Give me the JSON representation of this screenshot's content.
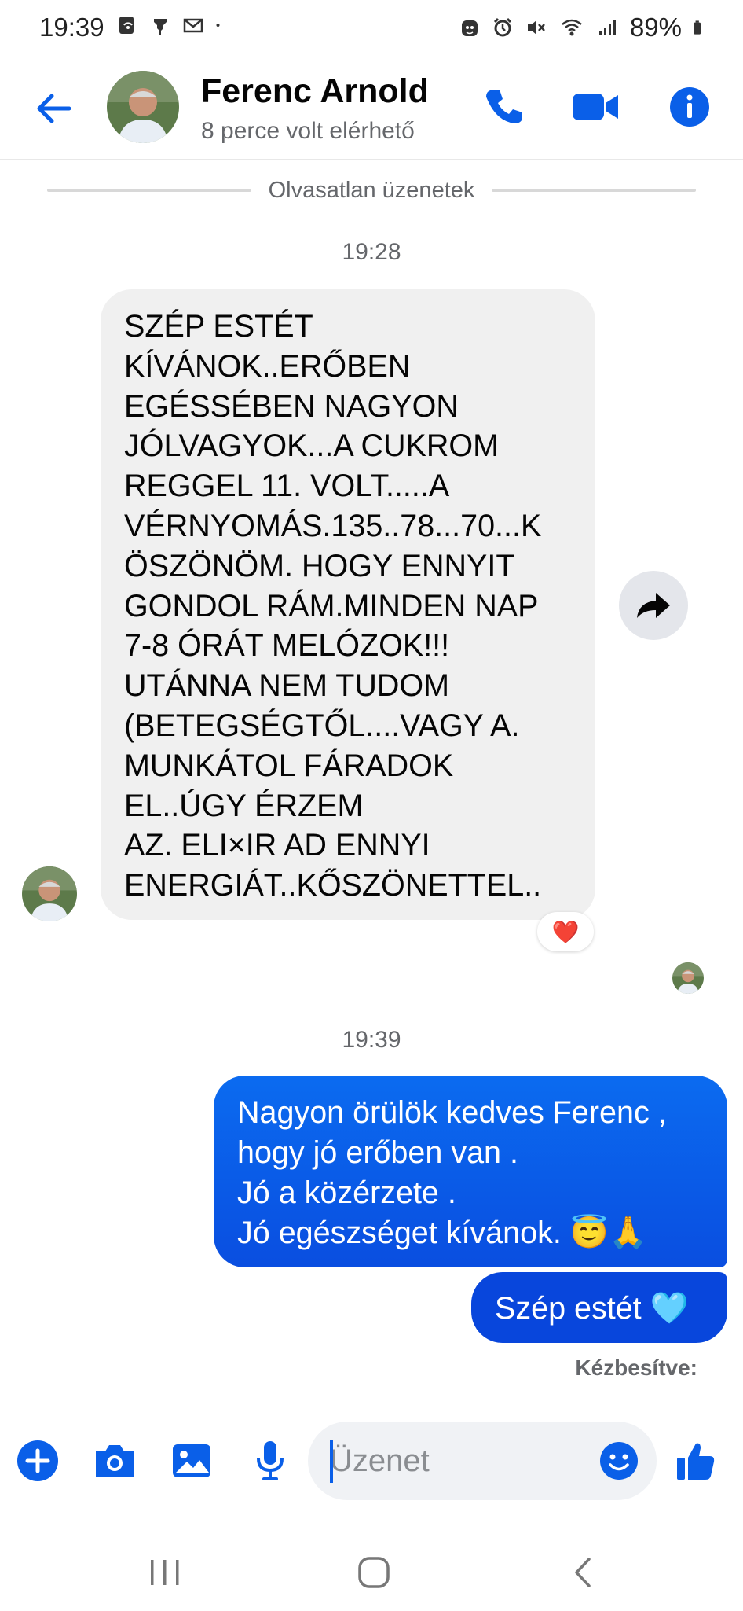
{
  "status_bar": {
    "time": "19:39",
    "battery": "89%",
    "icons_left": [
      "data-saver-icon",
      "pin-icon",
      "gmail-icon",
      "dot-icon"
    ],
    "icons_right": [
      "cat-icon",
      "alarm-icon",
      "mute-icon",
      "wifi-icon",
      "signal-icon",
      "battery-icon"
    ]
  },
  "header": {
    "contact_name": "Ferenc Arnold",
    "contact_status": "8 perce volt elérhető"
  },
  "conversation": {
    "unread_divider": "Olvasatlan üzenetek",
    "timestamp_1": "19:28",
    "received_message": "SZÉP ESTÉT\nKÍVÁNOK..ERŐBEN\nEGÉSSÉBEN NAGYON\nJÓLVAGYOK...A CUKROM\nREGGEL 11. VOLT.....A\nVÉRNYOMÁS.135..78...70...K\nÖSZÖNÖM. HOGY ENNYIT\nGONDOL RÁM.MINDEN NAP\n7-8 ÓRÁT MELÓZOK!!!\nUTÁNNA NEM TUDOM\n(BETEGSÉGTŐL....VAGY A.\nMUNKÁTOL FÁRADOK\nEL..ÚGY ÉRZEM\nAZ. ELI×IR AD ENNYI\nENERGIÁT..KŐSZÖNETTEL..",
    "reaction": "❤️",
    "timestamp_2": "19:39",
    "sent_message_1": "Nagyon örülök kedves Ferenc ,\nhogy jó erőben van .\nJó a közérzete .\nJó egészséget kívánok.  😇🙏",
    "sent_message_2": "Szép estét 🩵",
    "delivery_status": "Kézbesítve:"
  },
  "composer": {
    "placeholder": "Üzenet"
  },
  "colors": {
    "accent": "#0a5fe8",
    "sent_bubble": "#0846dc",
    "received_bubble": "#f0f0f0",
    "secondary_text": "#65676b"
  }
}
